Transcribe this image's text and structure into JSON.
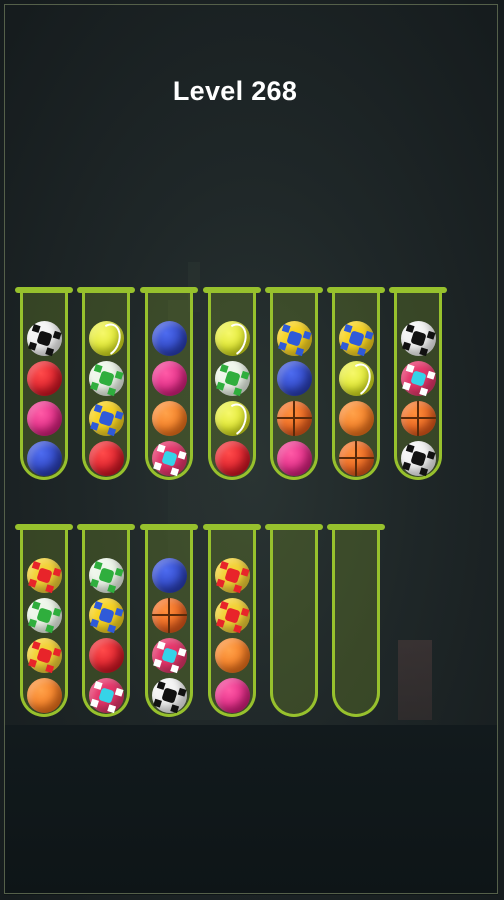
{
  "level_title": "Level 268",
  "tubes": [
    {
      "balls": [
        "soccer-white",
        "red",
        "pink",
        "blue"
      ]
    },
    {
      "balls": [
        "tennis",
        "soccer-green",
        "soccer-yellow",
        "red"
      ]
    },
    {
      "balls": [
        "blue",
        "pink",
        "orange",
        "soccer-cyan"
      ]
    },
    {
      "balls": [
        "tennis",
        "soccer-green",
        "tennis",
        "red"
      ]
    },
    {
      "balls": [
        "soccer-yellow",
        "blue",
        "basket",
        "pink"
      ]
    },
    {
      "balls": [
        "soccer-yellow",
        "tennis",
        "orange",
        "basket"
      ]
    },
    {
      "balls": [
        "soccer-white",
        "soccer-cyan",
        "basket",
        "soccer-white"
      ]
    },
    {
      "balls": [
        "soccer-red",
        "soccer-green",
        "soccer-red",
        "orange"
      ]
    },
    {
      "balls": [
        "soccer-green",
        "soccer-yellow",
        "red",
        "soccer-cyan"
      ]
    },
    {
      "balls": [
        "blue",
        "basket",
        "soccer-cyan",
        "soccer-white"
      ]
    },
    {
      "balls": [
        "soccer-red",
        "soccer-red",
        "orange",
        "pink"
      ]
    },
    {
      "balls": []
    },
    {
      "balls": []
    }
  ]
}
